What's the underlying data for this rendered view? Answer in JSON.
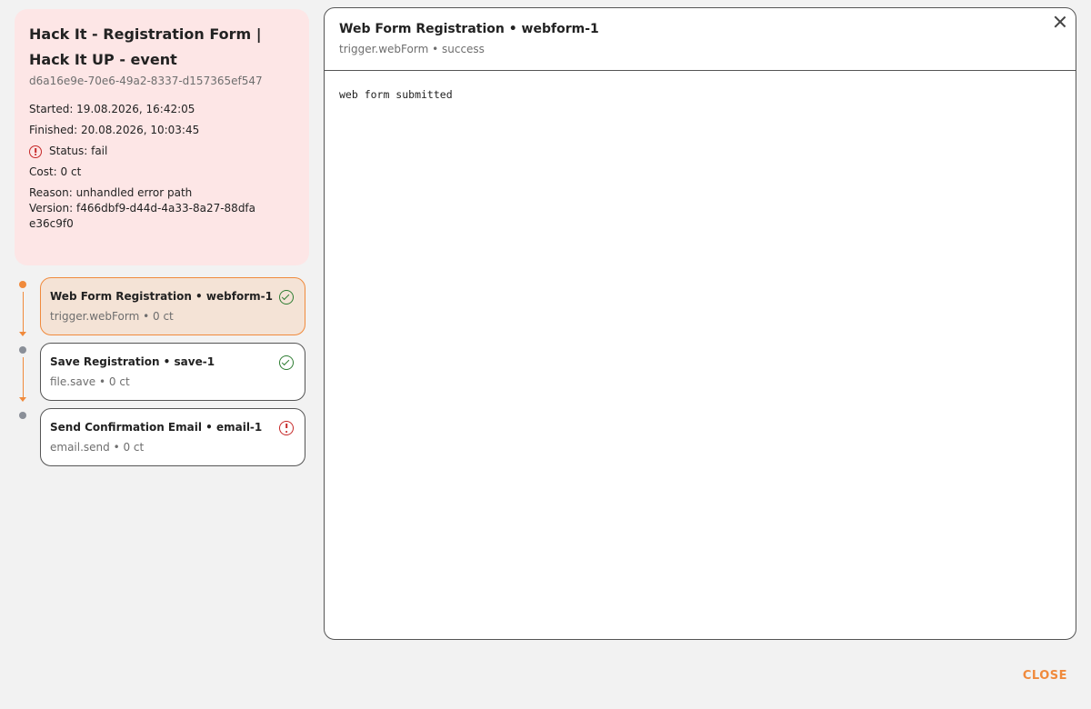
{
  "summary": {
    "title": "Hack It - Registration Form | Hack It UP - event",
    "id": "d6a16e9e-70e6-49a2-8337-d157365ef547",
    "started": "Started: 19.08.2026, 16:42:05",
    "finished": "Finished: 20.08.2026, 10:03:45",
    "status": "Status: fail",
    "status_icon": "error-circle-icon",
    "cost": "Cost: 0 ct",
    "reason": "Reason: unhandled error path",
    "version": "Version: f466dbf9-d44d-4a33-8a27-88dfae36c9f0",
    "background_color": "#fde6e6"
  },
  "steps": [
    {
      "title": "Web Form Registration • webform-1",
      "subtitle_type": "trigger.webForm",
      "subtitle_cost": "0 ct",
      "status_icon": "check-circle-icon",
      "selected": true
    },
    {
      "title": "Save Registration • save-1",
      "subtitle_type": "file.save",
      "subtitle_cost": "0 ct",
      "status_icon": "check-circle-icon",
      "selected": false
    },
    {
      "title": "Send Confirmation Email • email-1",
      "subtitle_type": "email.send",
      "subtitle_cost": "0 ct",
      "status_icon": "error-circle-icon",
      "selected": false
    }
  ],
  "detail": {
    "title": "Web Form Registration • webform-1",
    "subtitle": "trigger.webForm • success",
    "body": "web form submitted",
    "close_icon": "close-icon"
  },
  "footer": {
    "close_label": "CLOSE"
  },
  "colors": {
    "accent": "#f08a3c",
    "success": "#2e7d32",
    "error": "#c62828",
    "inactive_dot": "#8a8f98"
  }
}
